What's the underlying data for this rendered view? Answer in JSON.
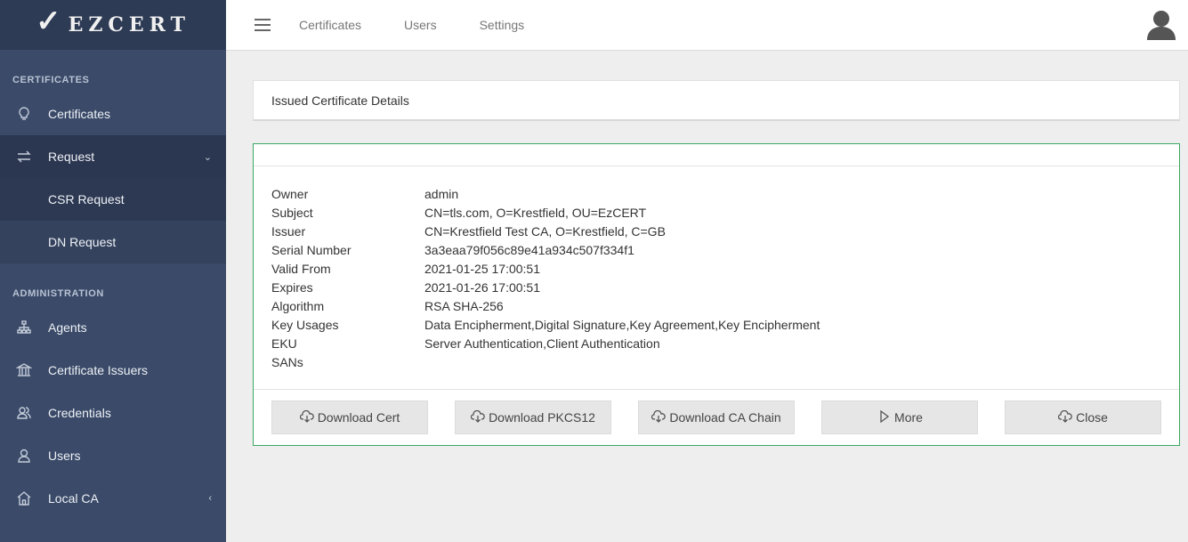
{
  "brand": {
    "logo_text": "EZCERT"
  },
  "sidebar": {
    "sections": [
      {
        "label": "CERTIFICATES"
      },
      {
        "label": "ADMINISTRATION"
      }
    ],
    "items": [
      {
        "label": "Certificates",
        "icon": "lightbulb-icon"
      },
      {
        "label": "Request",
        "icon": "arrows-swap-icon"
      },
      {
        "label": "CSR Request"
      },
      {
        "label": "DN Request"
      },
      {
        "label": "Agents",
        "icon": "hierarchy-icon"
      },
      {
        "label": "Certificate Issuers",
        "icon": "bank-icon"
      },
      {
        "label": "Credentials",
        "icon": "users-icon"
      },
      {
        "label": "Users",
        "icon": "user-icon"
      },
      {
        "label": "Local CA",
        "icon": "home-icon"
      }
    ]
  },
  "topbar": {
    "links": [
      "Certificates",
      "Users",
      "Settings"
    ]
  },
  "page": {
    "title": "Issued Certificate Details"
  },
  "details": [
    {
      "key": "Owner",
      "value": "admin"
    },
    {
      "key": "Subject",
      "value": "CN=tls.com, O=Krestfield, OU=EzCERT"
    },
    {
      "key": "Issuer",
      "value": "CN=Krestfield Test CA, O=Krestfield, C=GB"
    },
    {
      "key": "Serial Number",
      "value": "3a3eaa79f056c89e41a934c507f334f1"
    },
    {
      "key": "Valid From",
      "value": "2021-01-25 17:00:51"
    },
    {
      "key": "Expires",
      "value": "2021-01-26 17:00:51"
    },
    {
      "key": "Algorithm",
      "value": "RSA SHA-256"
    },
    {
      "key": "Key Usages",
      "value": "Data Encipherment,Digital Signature,Key Agreement,Key Encipherment"
    },
    {
      "key": "EKU",
      "value": "Server Authentication,Client Authentication"
    },
    {
      "key": "SANs",
      "value": ""
    }
  ],
  "buttons": [
    {
      "label": "Download Cert",
      "icon": "cloud-download-icon"
    },
    {
      "label": "Download PKCS12",
      "icon": "cloud-download-icon"
    },
    {
      "label": "Download CA Chain",
      "icon": "cloud-download-icon"
    },
    {
      "label": "More",
      "icon": "play-icon"
    },
    {
      "label": "Close",
      "icon": "cloud-download-icon"
    }
  ],
  "colors": {
    "sidebar_bg": "#3a4a68",
    "sidebar_active": "#2b3650",
    "details_border": "#3aa860"
  }
}
